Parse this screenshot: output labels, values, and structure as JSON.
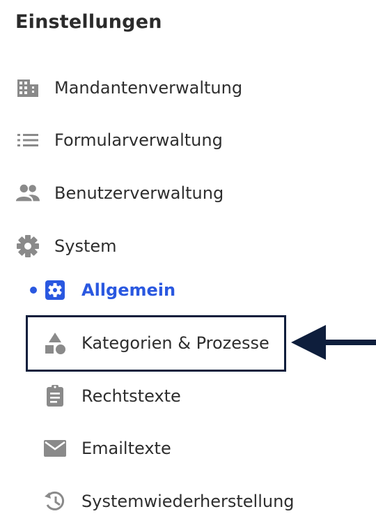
{
  "title": "Einstellungen",
  "menu": {
    "items": [
      {
        "label": "Mandantenverwaltung",
        "icon": "building-icon"
      },
      {
        "label": "Formularverwaltung",
        "icon": "list-icon"
      },
      {
        "label": "Benutzerverwaltung",
        "icon": "people-icon"
      },
      {
        "label": "System",
        "icon": "gear-icon"
      }
    ],
    "system_items": [
      {
        "label": "Allgemein",
        "icon": "settings-box-icon",
        "active": true
      },
      {
        "label": "Kategorien & Prozesse",
        "icon": "shapes-icon",
        "highlighted": true
      },
      {
        "label": "Rechtstexte",
        "icon": "clipboard-icon"
      },
      {
        "label": "Emailtexte",
        "icon": "envelope-icon"
      },
      {
        "label": "Systemwiederherstellung",
        "icon": "history-icon"
      }
    ]
  },
  "colors": {
    "active": "#2a58e0",
    "icon_gray": "#8a8a8a",
    "highlight_border": "#0e1e3c",
    "arrow": "#0e1e3c"
  }
}
